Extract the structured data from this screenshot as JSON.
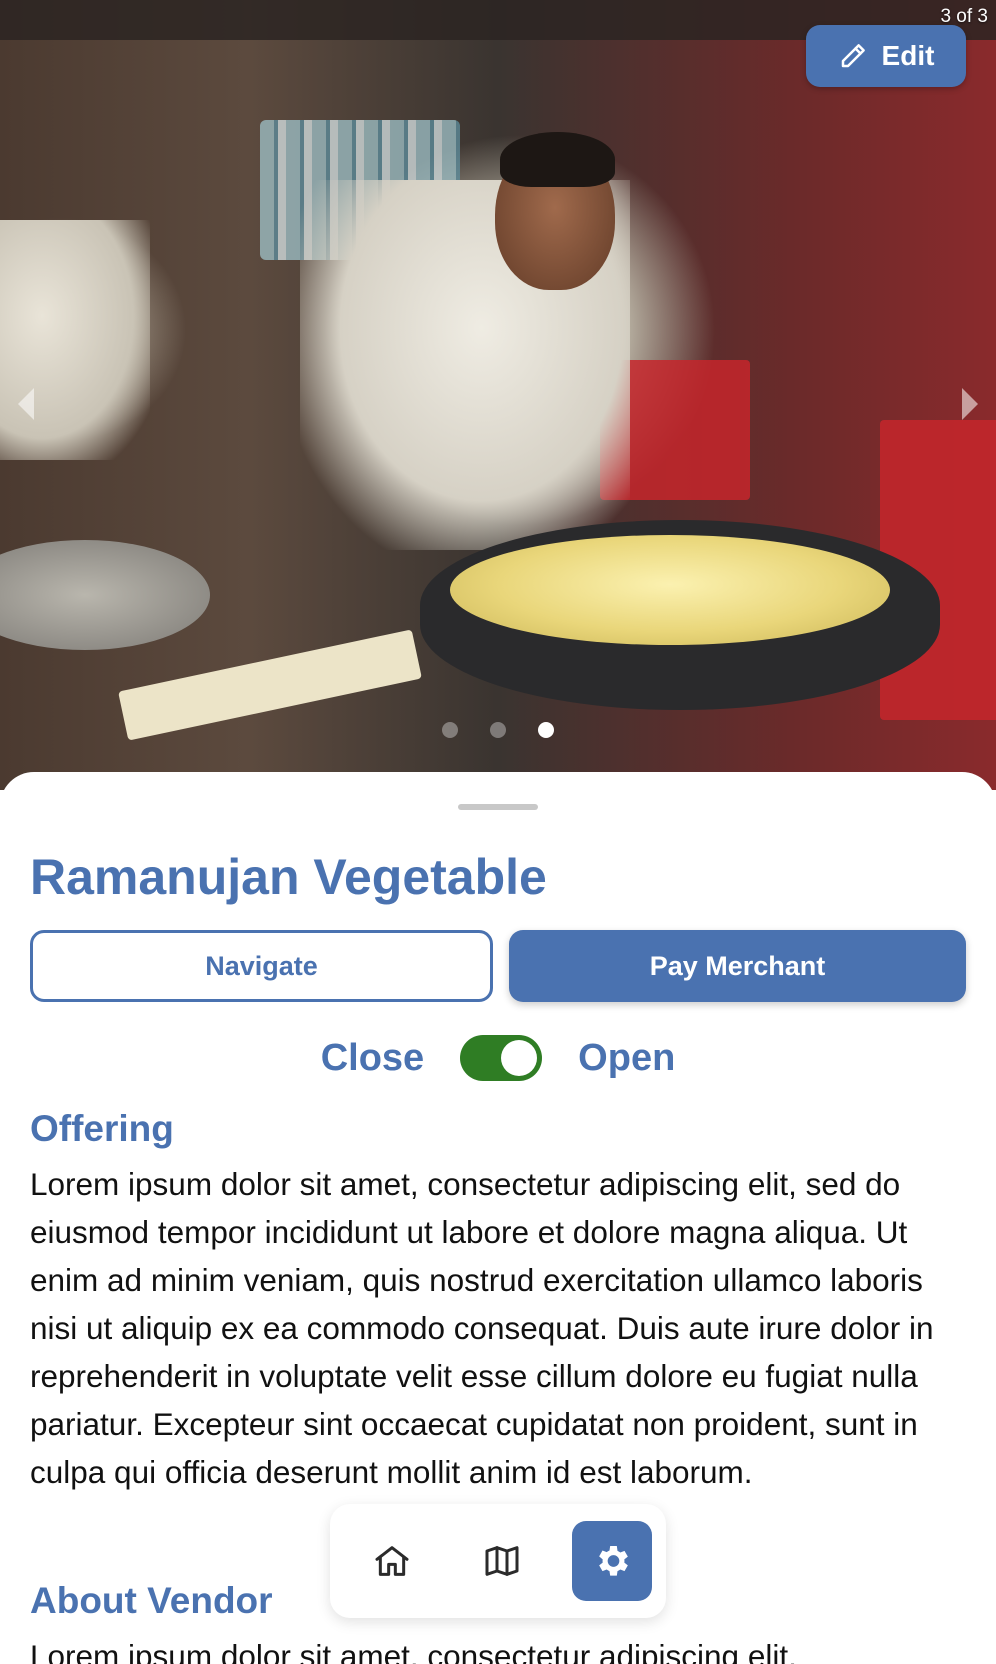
{
  "hero": {
    "page_counter": "3 of 3",
    "edit_label": "Edit",
    "carousel": {
      "total": 3,
      "active_index": 2
    },
    "icons": {
      "edit": "pencil-icon",
      "prev": "chevron-left-icon",
      "next": "chevron-right-icon"
    }
  },
  "vendor": {
    "name": "Ramanujan Vegetable",
    "navigate_label": "Navigate",
    "pay_label": "Pay Merchant",
    "status": {
      "close_label": "Close",
      "open_label": "Open",
      "is_open": true
    }
  },
  "offering": {
    "heading": "Offering",
    "text": "Lorem ipsum dolor sit amet, consectetur adipiscing elit, sed do eiusmod tempor incididunt ut labore et dolore magna aliqua. Ut enim ad minim veniam, quis nostrud exercitation ullamco laboris nisi ut aliquip ex ea commodo consequat. Duis aute irure dolor in reprehenderit in voluptate velit esse cillum dolore eu fugiat nulla pariatur. Excepteur sint occaecat cupidatat non proident, sunt in culpa qui officia deserunt mollit anim id est laborum."
  },
  "about": {
    "heading": "About Vendor",
    "text": "Lorem ipsum dolor sit amet, consectetur adipiscing elit,"
  },
  "nav": {
    "items": [
      {
        "icon": "home-icon",
        "active": false
      },
      {
        "icon": "map-icon",
        "active": false
      },
      {
        "icon": "gear-icon",
        "active": true
      }
    ]
  },
  "colors": {
    "accent": "#4a72b0",
    "toggle_on": "#2f7d24",
    "body_text": "#111111"
  }
}
